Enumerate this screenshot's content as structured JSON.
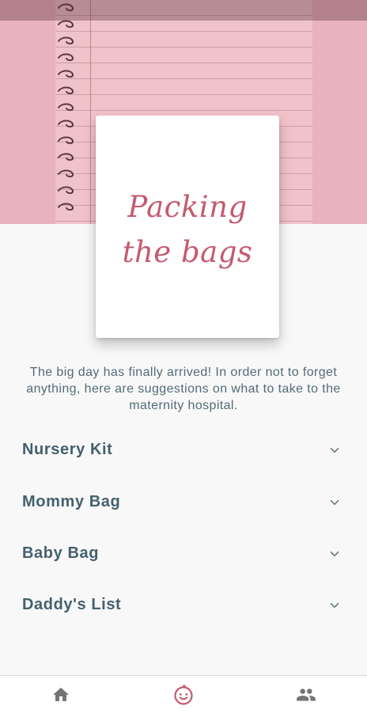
{
  "header": {
    "card_title": "Packing\nthe bags"
  },
  "intro": "The big day has finally arrived! In order not to forget anything, here are suggestions on what to take to the maternity hospital.",
  "sections": [
    {
      "label": "Nursery Kit",
      "icon": "chevron-down-icon"
    },
    {
      "label": "Mommy Bag",
      "icon": "chevron-down-icon"
    },
    {
      "label": "Baby Bag",
      "icon": "chevron-down-icon"
    },
    {
      "label": "Daddy's List",
      "icon": "chevron-down-icon"
    }
  ],
  "nav": [
    {
      "icon": "home-icon",
      "active": false
    },
    {
      "icon": "baby-face-icon",
      "active": true
    },
    {
      "icon": "people-icon",
      "active": false
    }
  ],
  "colors": {
    "accent": "#c45a6e",
    "hero_bg": "#e8b3bc",
    "text_heading": "#45606d",
    "text_body": "#536b77",
    "nav_icon": "#757575"
  }
}
